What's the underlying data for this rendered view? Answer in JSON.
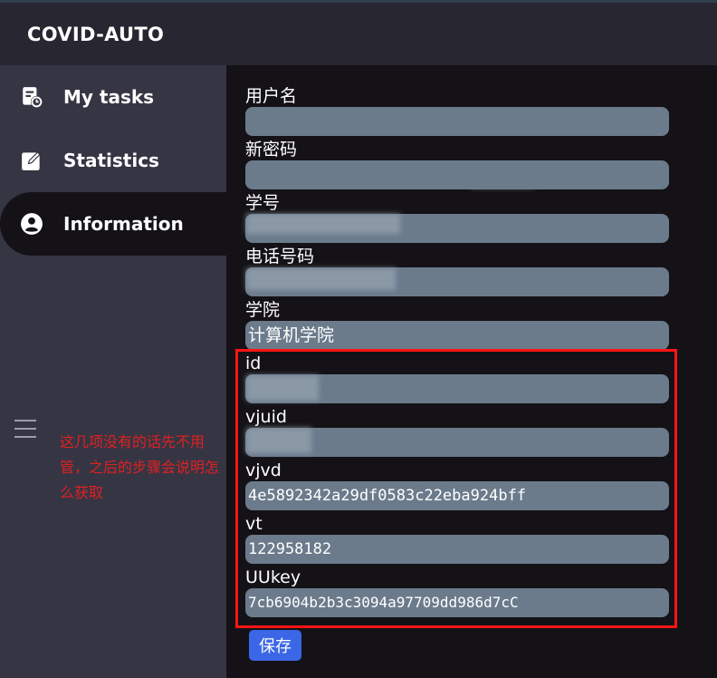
{
  "app": {
    "title": "COVID-AUTO"
  },
  "sidebar": {
    "items": [
      {
        "label": "My tasks",
        "icon": "task-clock-icon"
      },
      {
        "label": "Statistics",
        "icon": "edit-icon"
      },
      {
        "label": "Information",
        "icon": "account-circle-icon",
        "active": true
      }
    ],
    "menu_icon": "hamburger-menu-icon"
  },
  "note": {
    "text": "这几项没有的话先不用管，之后的步骤会说明怎么获取",
    "color": "#e02020"
  },
  "form": {
    "fields": [
      {
        "label": "用户名",
        "value": ""
      },
      {
        "label": "新密码",
        "value": ""
      },
      {
        "label": "学号",
        "value": ""
      },
      {
        "label": "电话号码",
        "value": ""
      },
      {
        "label": "学院",
        "value": "计算机学院"
      },
      {
        "label": "id",
        "value": ""
      },
      {
        "label": "vjuid",
        "value": ""
      },
      {
        "label": "vjvd",
        "value": "4e5892342a29df0583c22eba924bff"
      },
      {
        "label": "vt",
        "value": "122958182"
      },
      {
        "label": "UUkey",
        "value": "7cb6904b2b3c3094a97709dd986d7cC"
      }
    ],
    "save_label": "保存"
  },
  "colors": {
    "topbar": "#272631",
    "sidebar": "#363544",
    "main_bg": "#141216",
    "input_bg": "#6b7b8c",
    "highlight_border": "#ff1414",
    "save_button": "#3b66e6"
  }
}
